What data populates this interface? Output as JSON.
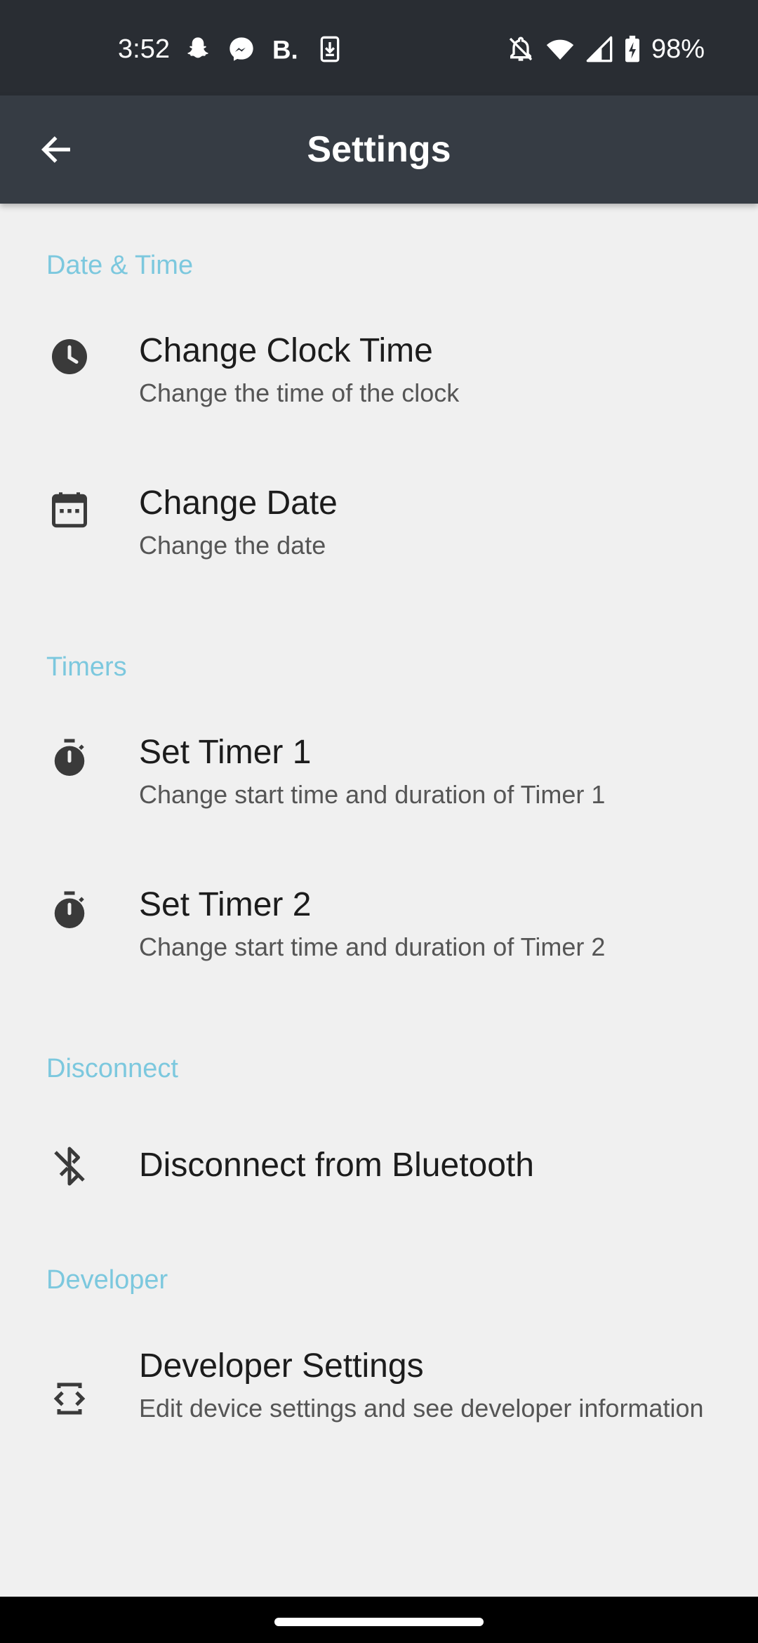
{
  "status_bar": {
    "time": "3:52",
    "left_icons": [
      "snapchat-icon",
      "messenger-icon",
      "b-app-icon",
      "download-icon"
    ],
    "right_icons": [
      "notifications-off-icon",
      "wifi-icon",
      "signal-icon",
      "battery-charging-icon"
    ],
    "battery": "98%"
  },
  "app_bar": {
    "title": "Settings",
    "back_icon": "arrow-back-icon"
  },
  "sections": {
    "date_time": {
      "header": "Date & Time",
      "items": [
        {
          "title": "Change Clock Time",
          "subtitle": "Change the time of the clock",
          "icon": "clock-icon"
        },
        {
          "title": "Change Date",
          "subtitle": "Change the date",
          "icon": "calendar-icon"
        }
      ]
    },
    "timers": {
      "header": "Timers",
      "items": [
        {
          "title": "Set Timer 1",
          "subtitle": "Change start time and duration of Timer 1",
          "icon": "timer-icon"
        },
        {
          "title": "Set Timer 2",
          "subtitle": "Change start time and duration of Timer 2",
          "icon": "timer-icon"
        }
      ]
    },
    "disconnect": {
      "header": "Disconnect",
      "items": [
        {
          "title": "Disconnect from Bluetooth",
          "icon": "bluetooth-disabled-icon"
        }
      ]
    },
    "developer": {
      "header": "Developer",
      "items": [
        {
          "title": "Developer Settings",
          "subtitle": "Edit device settings and see developer information",
          "icon": "developer-mode-icon"
        }
      ]
    }
  },
  "colors": {
    "status_bar_bg": "#292d33",
    "app_bar_bg": "#363c44",
    "page_bg": "#f0f0f0",
    "section_header": "#7cc8de",
    "title_text": "#1c1c1c",
    "subtitle_text": "#555555",
    "icon": "#3a3a3a"
  }
}
